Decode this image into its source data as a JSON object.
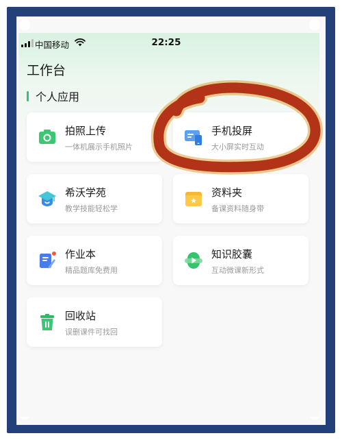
{
  "status_bar": {
    "carrier": "中国移动",
    "time": "22:25"
  },
  "page": {
    "title": "工作台",
    "section_title": "个人应用"
  },
  "apps": [
    {
      "title": "拍照上传",
      "subtitle": "一体机展示手机照片",
      "icon": "camera-icon"
    },
    {
      "title": "手机投屏",
      "subtitle": "大小屏实时互动",
      "icon": "screen-cast-icon"
    },
    {
      "title": "希沃学苑",
      "subtitle": "教学技能轻松学",
      "icon": "graduation-cap-icon"
    },
    {
      "title": "资料夹",
      "subtitle": "备课资料随身带",
      "icon": "folder-icon"
    },
    {
      "title": "作业本",
      "subtitle": "精品题库免费用",
      "icon": "notebook-icon"
    },
    {
      "title": "知识胶囊",
      "subtitle": "互动微课新形式",
      "icon": "capsule-play-icon"
    },
    {
      "title": "回收站",
      "subtitle": "误删课件可找回",
      "icon": "recycle-bin-icon"
    }
  ],
  "colors": {
    "accent_green": "#34c46b",
    "frame_blue": "#24407a",
    "annotation_red": "#b23317"
  }
}
